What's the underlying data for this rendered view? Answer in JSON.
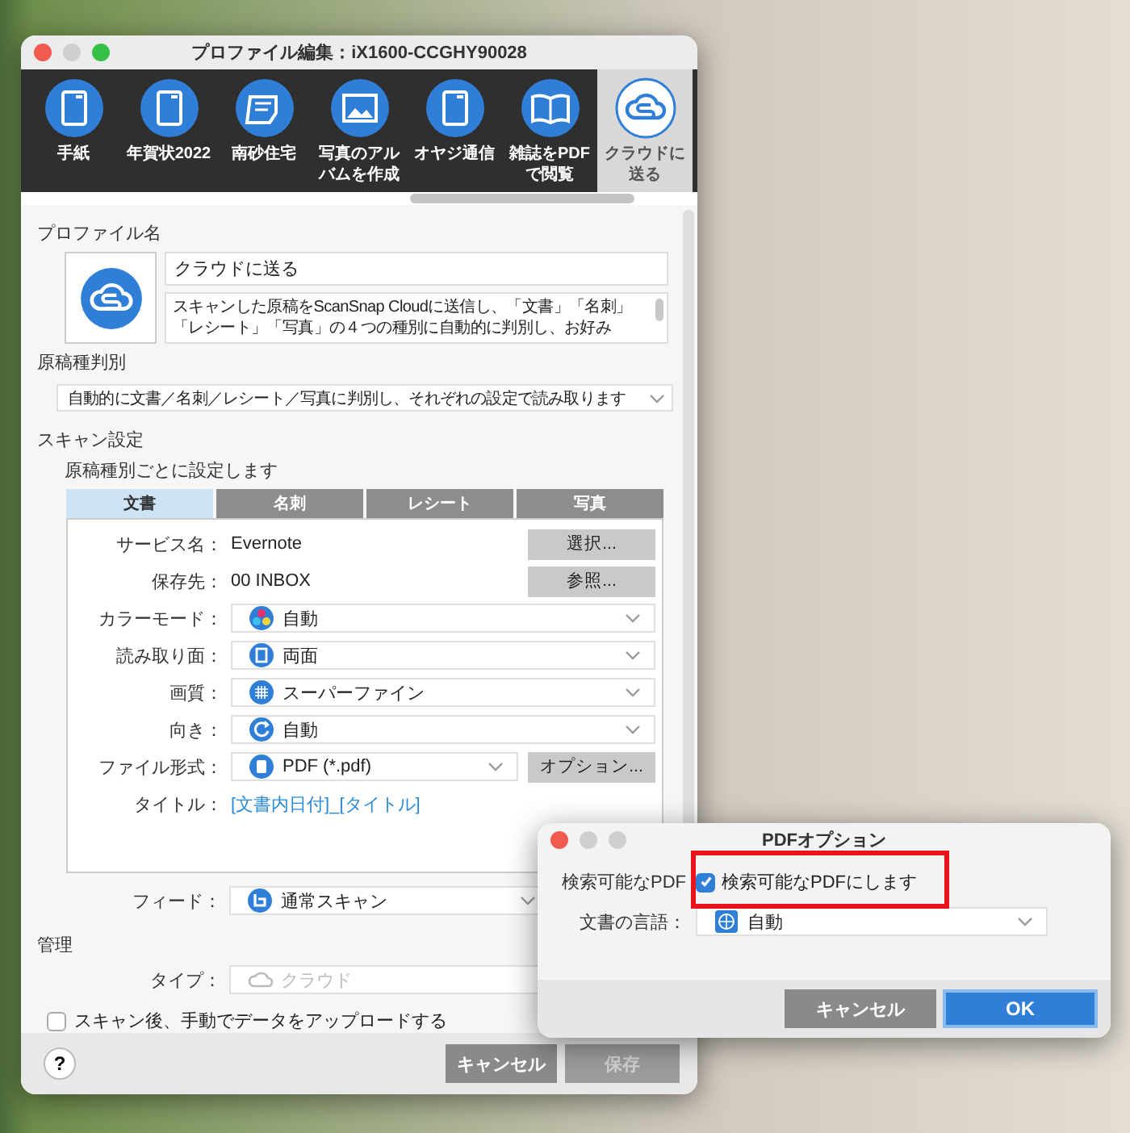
{
  "main_window": {
    "title": "プロファイル編集：iX1600-CCGHY90028",
    "toolbar": [
      {
        "label": "手紙",
        "selected": false
      },
      {
        "label": "年賀状2022",
        "selected": false
      },
      {
        "label": "南砂住宅",
        "selected": false
      },
      {
        "label": "写真のアルバムを作成",
        "selected": false
      },
      {
        "label": "オヤジ通信",
        "selected": false
      },
      {
        "label": "雑誌をPDFで閲覧",
        "selected": false
      },
      {
        "label": "クラウドに送る",
        "selected": true
      }
    ],
    "profile_name": {
      "heading": "プロファイル名",
      "name": "クラウドに送る",
      "description": "スキャンした原稿をScanSnap Cloudに送信し、「文書」「名刺」「レシート」「写真」の４つの種別に自動的に判別し、お好み"
    },
    "detection": {
      "heading": "原稿種判別",
      "value": "自動的に文書／名刺／レシート／写真に判別し、それぞれの設定で読み取ります"
    },
    "scan_settings": {
      "heading": "スキャン設定",
      "subheading": "原稿種別ごとに設定します",
      "tabs": [
        {
          "label": "文書",
          "selected": true
        },
        {
          "label": "名刺",
          "selected": false
        },
        {
          "label": "レシート",
          "selected": false
        },
        {
          "label": "写真",
          "selected": false
        }
      ],
      "fields": [
        {
          "kind": "text",
          "label": "サービス名：",
          "value": "Evernote",
          "button": "選択..."
        },
        {
          "kind": "text",
          "label": "保存先：",
          "value": "00 INBOX",
          "button": "参照..."
        },
        {
          "kind": "select",
          "label": "カラーモード：",
          "value": "自動"
        },
        {
          "kind": "select",
          "label": "読み取り面：",
          "value": "両面"
        },
        {
          "kind": "select",
          "label": "画質：",
          "value": "スーパーファイン"
        },
        {
          "kind": "select",
          "label": "向き：",
          "value": "自動"
        },
        {
          "kind": "select",
          "label": "ファイル形式：",
          "value": "PDF (*.pdf)",
          "button": "オプション..."
        },
        {
          "kind": "link",
          "label": "タイトル：",
          "value": "[文書内日付]_[タイトル]"
        }
      ],
      "feed": {
        "label": "フィード：",
        "value": "通常スキャン"
      }
    },
    "management": {
      "heading": "管理",
      "type": {
        "label": "タイプ：",
        "value": "クラウド",
        "disabled": true
      }
    },
    "upload": {
      "label": "スキャン後、手動でデータをアップロードする",
      "checked": false
    },
    "help": "?",
    "buttons": [
      {
        "label": "キャンセル",
        "disabled": false
      },
      {
        "label": "保存",
        "disabled": true
      }
    ]
  },
  "dialog": {
    "title": "PDFオプション",
    "searchable": {
      "label": "検索可能なPDF",
      "checkbox_label": "検索可能なPDFにします",
      "checked": true
    },
    "language": {
      "label": "文書の言語：",
      "value": "自動"
    },
    "buttons": [
      {
        "label": "キャンセル",
        "primary": false
      },
      {
        "label": "OK",
        "primary": true
      }
    ]
  }
}
